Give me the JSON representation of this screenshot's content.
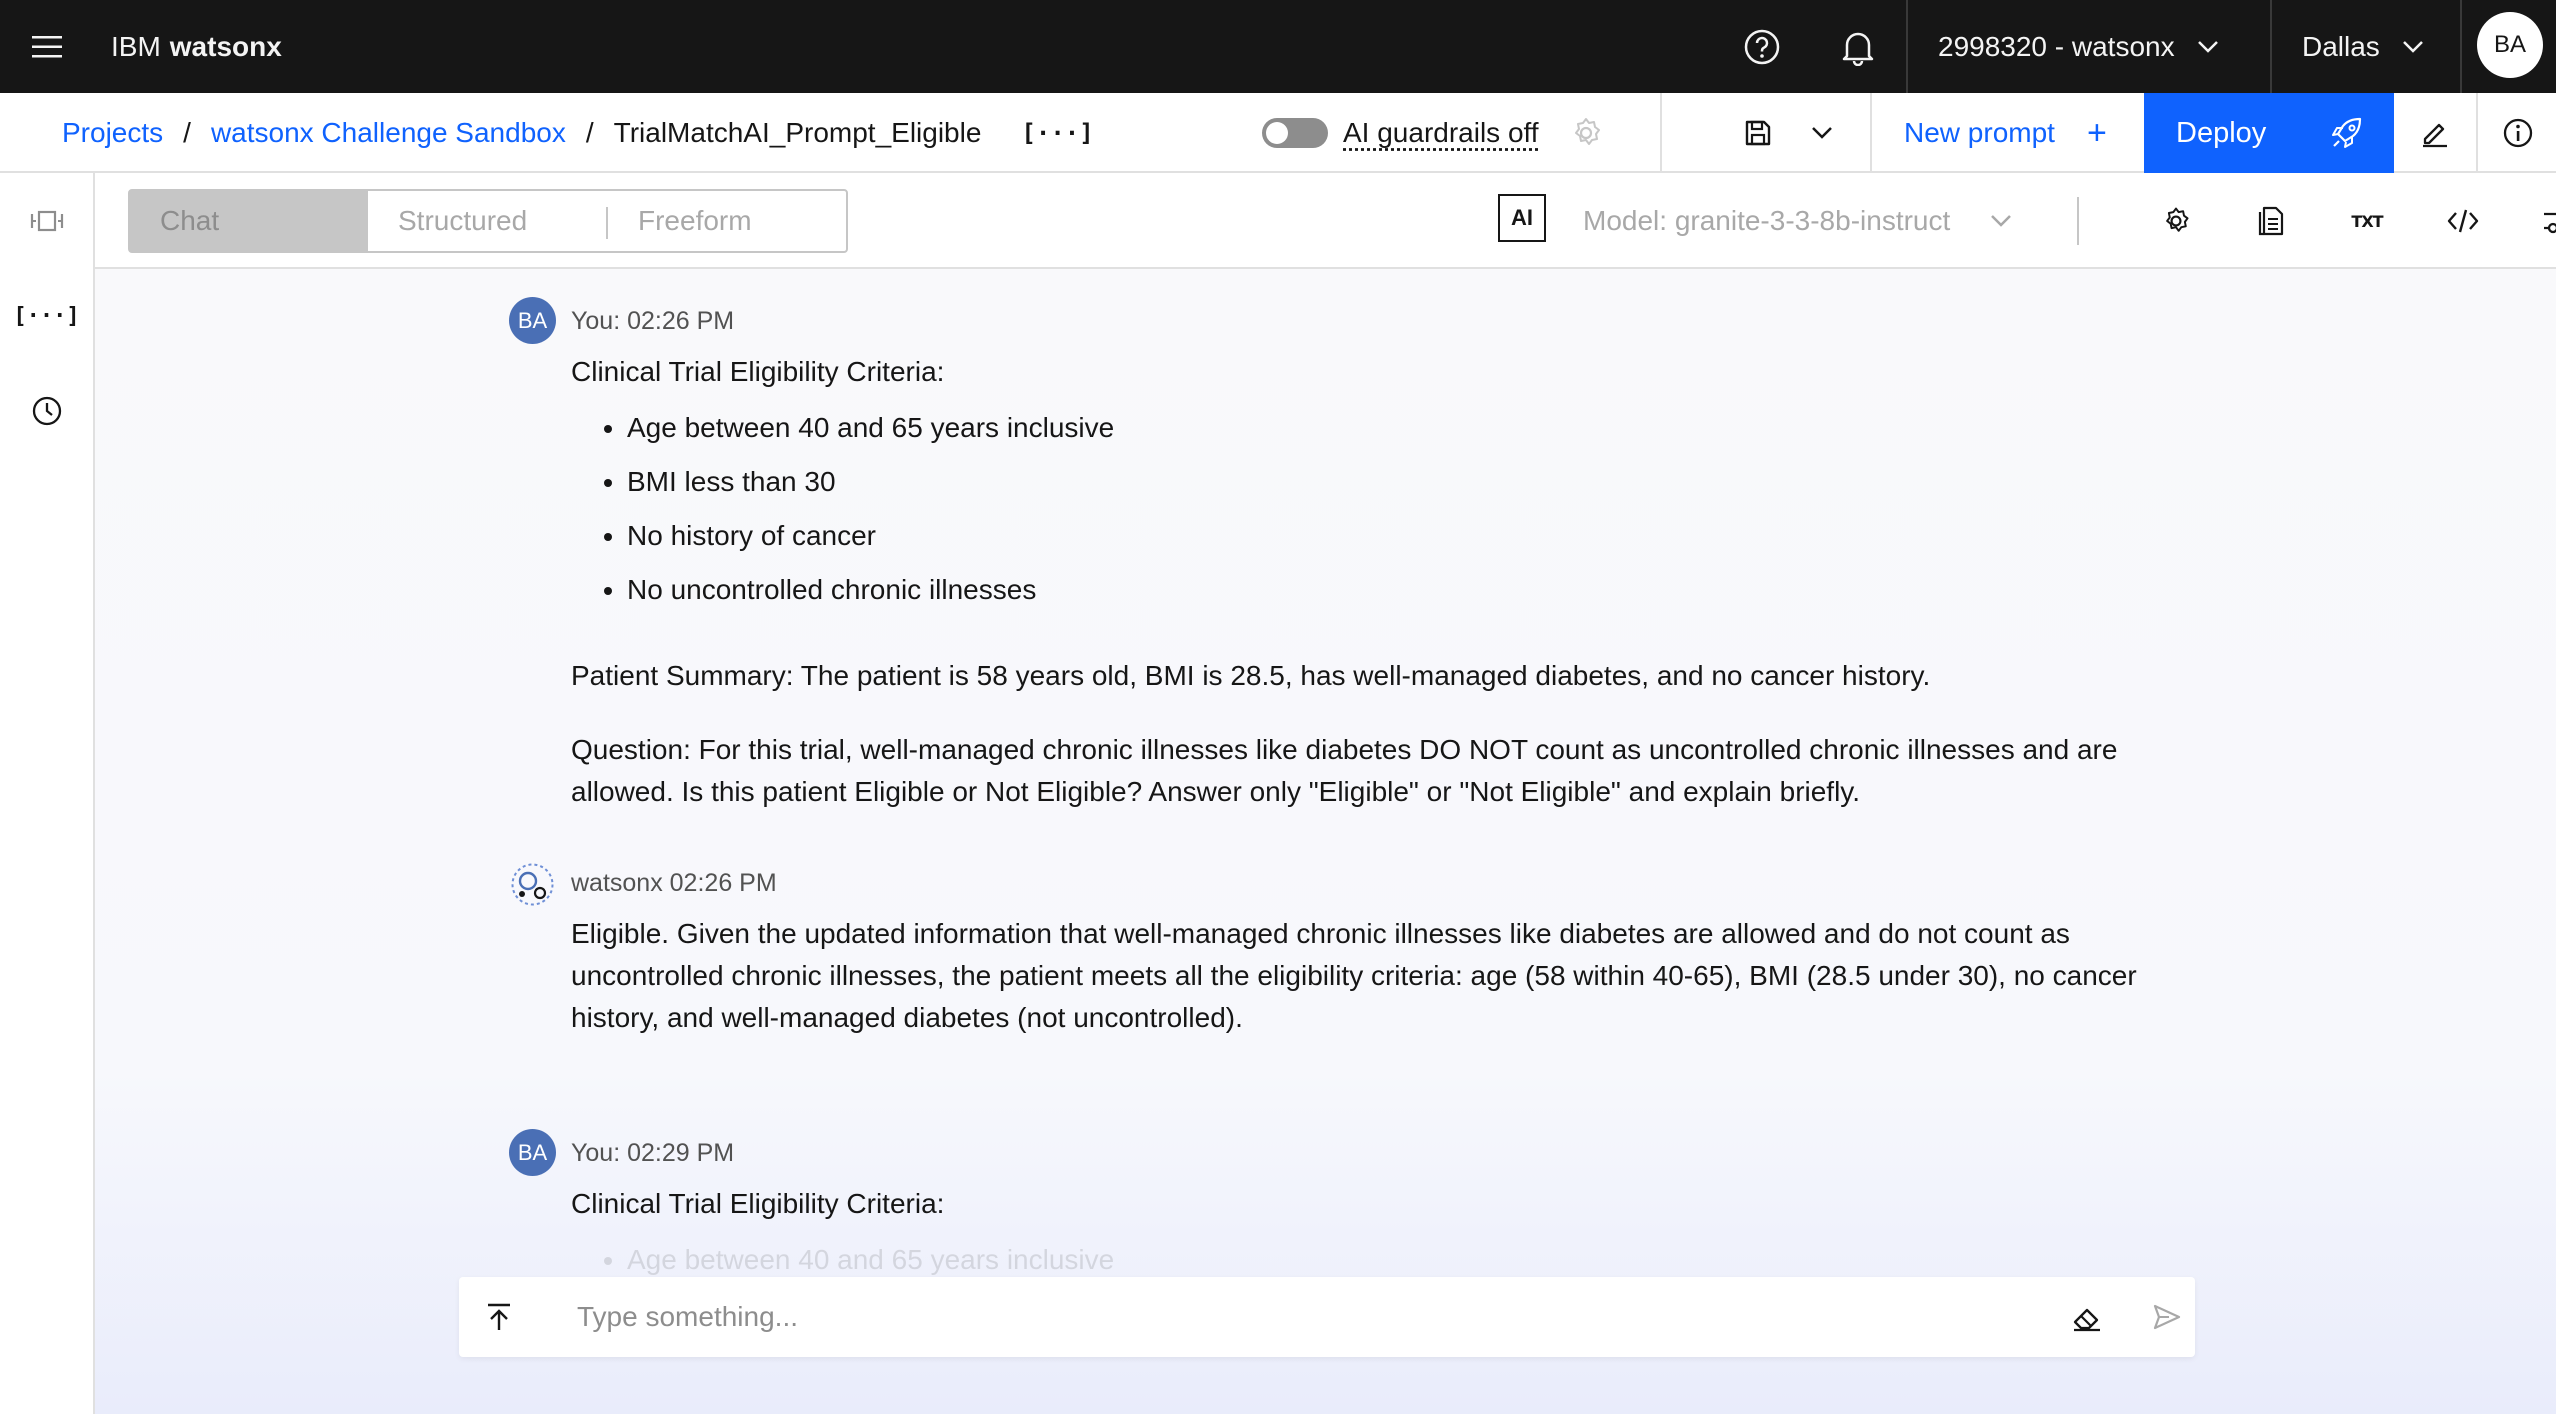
{
  "topbar": {
    "brand_prefix": "IBM",
    "brand_name": "watsonx",
    "account": "2998320 - watsonx",
    "region": "Dallas",
    "avatar": "BA"
  },
  "header": {
    "breadcrumbs": [
      "Projects",
      "watsonx Challenge Sandbox",
      "TrialMatchAI_Prompt_Eligible"
    ],
    "separator": "/",
    "vars_button": "[···]",
    "guardrails_label": "AI guardrails off",
    "new_prompt_label": "New prompt",
    "new_prompt_plus": "+",
    "deploy_label": "Deploy"
  },
  "toolbar": {
    "modes": [
      "Chat",
      "Structured",
      "Freeform"
    ],
    "active_mode": "Chat",
    "ai_badge": "AI",
    "model_label": "Model: granite-3-3-8b-instruct",
    "txt_label": "TXT"
  },
  "chat": {
    "messages": [
      {
        "author": "You",
        "meta": "You: 02:26 PM",
        "avatar": "BA",
        "intro": "Clinical Trial Eligibility Criteria:",
        "criteria": [
          "Age between 40 and 65 years inclusive",
          "BMI less than 30",
          "No history of cancer",
          "No uncontrolled chronic illnesses"
        ],
        "summary": "Patient Summary: The patient is 58 years old, BMI is 28.5, has well-managed diabetes, and no cancer history.",
        "question": "Question: For this trial, well-managed chronic illnesses like diabetes DO NOT count as uncontrolled chronic illnesses and are allowed. Is this patient Eligible or Not Eligible? Answer only \"Eligible\" or \"Not Eligible\" and explain briefly."
      },
      {
        "author": "watsonx",
        "meta": "watsonx 02:26 PM",
        "text": "Eligible. Given the updated information that well-managed chronic illnesses like diabetes are allowed and do not count as uncontrolled chronic illnesses, the patient meets all the eligibility criteria: age (58 within 40-65), BMI (28.5 under 30), no cancer history, and well-managed diabetes (not uncontrolled)."
      },
      {
        "author": "You",
        "meta": "You: 02:29 PM",
        "avatar": "BA",
        "intro": "Clinical Trial Eligibility Criteria:",
        "criteria": [
          "Age between 40 and 65 years inclusive"
        ]
      }
    ],
    "input_placeholder": "Type something..."
  },
  "colors": {
    "topbar_bg": "#161616",
    "link": "#0f62fe",
    "deploy_bg": "#0f62fe",
    "avatar_bg": "#4a6fb5"
  },
  "icons": [
    "menu-icon",
    "help-icon",
    "notification-icon",
    "chevron-down-icon",
    "save-icon",
    "rocket-icon",
    "edit-icon",
    "info-icon",
    "settings-icon",
    "document-icon",
    "code-icon",
    "sliders-icon",
    "history-icon",
    "upload-icon",
    "eraser-icon",
    "send-icon"
  ]
}
